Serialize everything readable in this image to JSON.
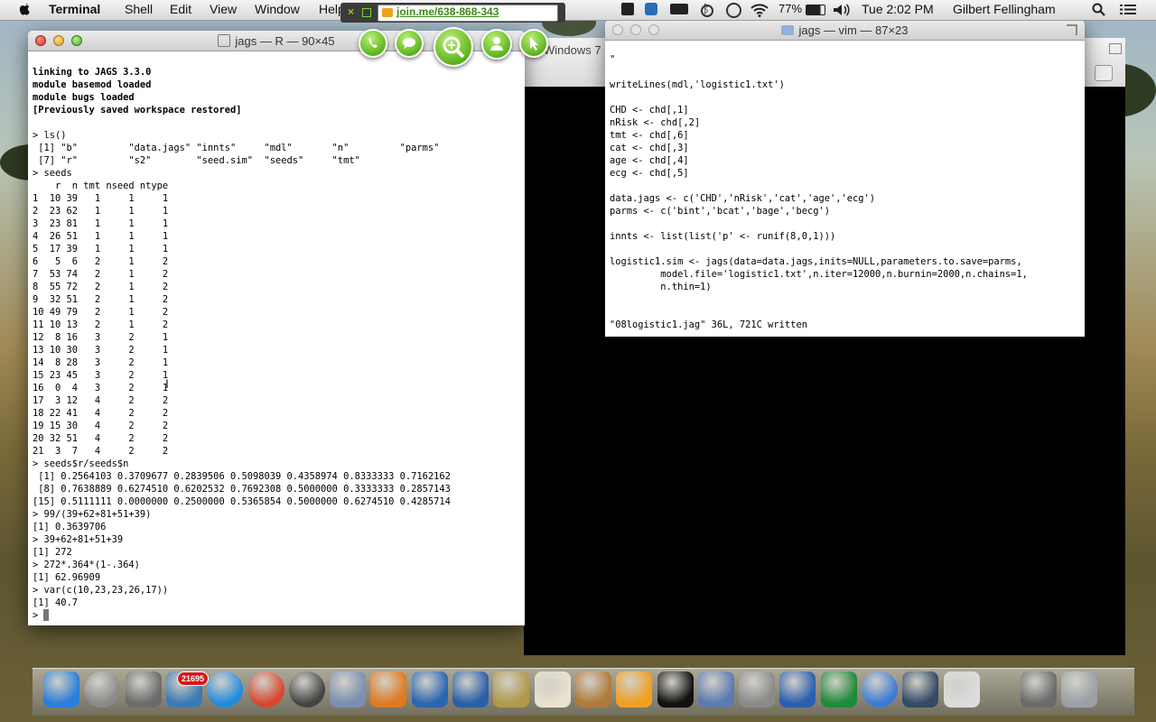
{
  "menubar": {
    "app": "Terminal",
    "items": [
      "Shell",
      "Edit",
      "View",
      "Window",
      "Help"
    ],
    "battery": "77%",
    "clock": "Tue 2:02 PM",
    "user": "Gilbert Fellingham"
  },
  "joinme": {
    "url": "join.me/638-868-343"
  },
  "r_window": {
    "title": "jags — R — 90×45",
    "lines": [
      "linking to JAGS 3.3.0",
      "module basemod loaded",
      "module bugs loaded",
      "[Previously saved workspace restored]",
      "",
      "> ls()",
      " [1] \"b\"         \"data.jags\" \"innts\"     \"mdl\"       \"n\"         \"parms\"",
      " [7] \"r\"         \"s2\"        \"seed.sim\"  \"seeds\"     \"tmt\"",
      "> seeds",
      "    r  n tmt nseed ntype",
      "1  10 39   1     1     1",
      "2  23 62   1     1     1",
      "3  23 81   1     1     1",
      "4  26 51   1     1     1",
      "5  17 39   1     1     1",
      "6   5  6   2     1     2",
      "7  53 74   2     1     2",
      "8  55 72   2     1     2",
      "9  32 51   2     1     2",
      "10 49 79   2     1     2",
      "11 10 13   2     1     2",
      "12  8 16   3     2     1",
      "13 10 30   3     2     1",
      "14  8 28   3     2     1",
      "15 23 45   3     2     1",
      "16  0  4   3     2     1",
      "17  3 12   4     2     2",
      "18 22 41   4     2     2",
      "19 15 30   4     2     2",
      "20 32 51   4     2     2",
      "21  3  7   4     2     2",
      "> seeds$r/seeds$n",
      " [1] 0.2564103 0.3709677 0.2839506 0.5098039 0.4358974 0.8333333 0.7162162",
      " [8] 0.7638889 0.6274510 0.6202532 0.7692308 0.5000000 0.3333333 0.2857143",
      "[15] 0.5111111 0.0000000 0.2500000 0.5365854 0.5000000 0.6274510 0.4285714",
      "> 99/(39+62+81+51+39)",
      "[1] 0.3639706",
      "> 39+62+81+51+39",
      "[1] 272",
      "> 272*.364*(1-.364)",
      "[1] 62.96909",
      "> var(c(10,23,23,26,17))",
      "[1] 40.7",
      "> "
    ]
  },
  "vim_window": {
    "title": "jags — vim — 87×23",
    "lines": [
      "\"",
      "",
      "writeLines(mdl,'logistic1.txt')",
      "",
      "CHD <- chd[,1]",
      "nRisk <- chd[,2]",
      "tmt <- chd[,6]",
      "cat <- chd[,3]",
      "age <- chd[,4]",
      "ecg <- chd[,5]",
      "",
      "data.jags <- c('CHD','nRisk','cat','age','ecg')",
      "parms <- c('bint','bcat','bage','becg')",
      "",
      "innts <- list(list('p' <- runif(8,0,1)))",
      "",
      "logistic1.sim <- jags(data=data.jags,inits=NULL,parameters.to.save=parms,",
      "         model.file='logistic1.txt',n.iter=12000,n.burnin=2000,n.chains=1,",
      "         n.thin=1)",
      "",
      "",
      "\"08logistic1.jag\" 36L, 721C written"
    ]
  },
  "vm_window": {
    "title": "Windows 7"
  },
  "dock": {
    "badge": "21695",
    "icons": [
      "finder-icon",
      "launchpad-icon",
      "system-info-icon",
      "mail-icon",
      "app-store-icon",
      "chrome-icon",
      "dashboard-icon",
      "iphoto-icon",
      "firefox-icon",
      "r-icon",
      "pandora-icon",
      "latex-icon",
      "textedit-icon",
      "address-book-icon",
      "joinme-icon",
      "terminal-icon",
      "vmware-icon",
      "system-preferences-icon",
      "word-icon",
      "excel-icon",
      "itunes-icon",
      "quicktime-icon",
      "preview-icon",
      "downloads-icon",
      "trash-icon"
    ],
    "colors": [
      "#2a7fd8",
      "#8a8a8a",
      "#6b6b6b",
      "#3a7ab5",
      "#1f8be0",
      "#d9452f",
      "#444444",
      "#7a8fb0",
      "#e07a1f",
      "#2a66b0",
      "#2a5fa8",
      "#b09a4a",
      "#e8e2cf",
      "#b07a3a",
      "#f0a020",
      "#111111",
      "#5a7ab0",
      "#8a8a8a",
      "#2a5faf",
      "#1e8a3a",
      "#3a7ad8",
      "#334a66",
      "#dcdcdc",
      "#6a6a6a",
      "#9aa0a6"
    ]
  }
}
